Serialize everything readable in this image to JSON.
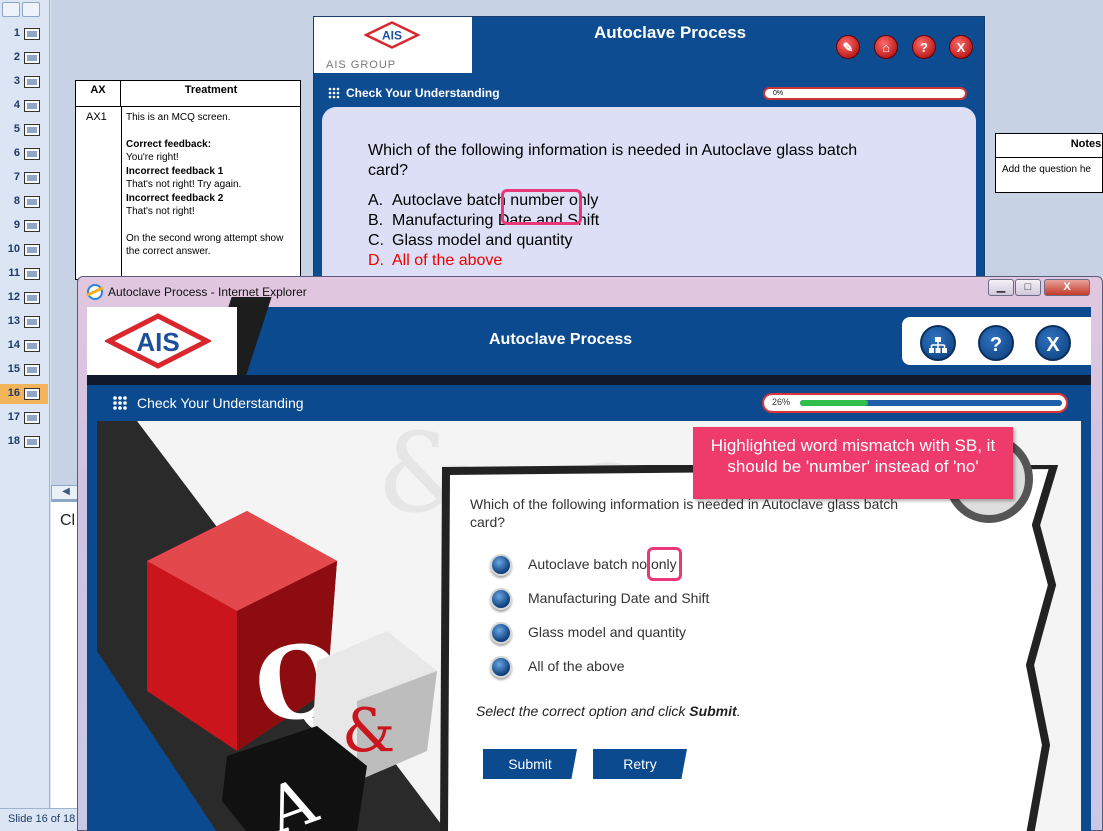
{
  "ppt": {
    "slide_numbers": [
      "1",
      "2",
      "3",
      "4",
      "5",
      "6",
      "7",
      "8",
      "9",
      "10",
      "11",
      "12",
      "13",
      "14",
      "15",
      "16",
      "17",
      "18"
    ],
    "active_slide": "16",
    "status": "Slide 16 of 18",
    "notes_peek": "Cl"
  },
  "treatment_table": {
    "col_ax": "AX",
    "col_treatment": "Treatment",
    "ax_value": "AX1",
    "line1": "This is an MCQ screen.",
    "correct_title": "Correct feedback:",
    "correct_text": "You're right!",
    "incorrect1_title": "Incorrect feedback 1",
    "incorrect1_text": "That's not right! Try again.",
    "incorrect2_title": "Incorrect feedback 2",
    "incorrect2_text": "That's not right!",
    "second_attempt": "On the second wrong attempt show the correct answer."
  },
  "notes_table": {
    "header": "Notes",
    "cell": "Add the question he"
  },
  "storyboard": {
    "logo_text": "AIS",
    "logo_sub": "AIS GROUP",
    "title": "Autoclave Process",
    "section": "Check Your Understanding",
    "progress_label": "0%",
    "question": "Which of the following information is needed in Autoclave glass batch card?",
    "options": [
      {
        "letter": "A.",
        "text": "Autoclave batch number only"
      },
      {
        "letter": "B.",
        "text": "Manufacturing Date and Shift"
      },
      {
        "letter": "C.",
        "text": "Glass model and quantity"
      },
      {
        "letter": "D.",
        "text": "All of the above"
      }
    ]
  },
  "ie": {
    "window_title": "Autoclave Process - Internet Explorer",
    "min": "▁",
    "max": "□",
    "close": "X"
  },
  "course": {
    "logo_text": "AIS",
    "title": "Autoclave Process",
    "btn_sitemap_icon": "sitemap-icon",
    "btn_help": "?",
    "btn_exit": "X",
    "section": "Check Your Understanding",
    "progress_label": "26%",
    "progress_value": 0.26,
    "question": "Which of the following information is needed in Autoclave glass batch card?",
    "options": [
      "Autoclave batch no only",
      "Manufacturing Date and Shift",
      "Glass model and quantity",
      "All of the above"
    ],
    "instruction_prefix": "Select the correct option and click ",
    "instruction_bold": "Submit",
    "instruction_suffix": ".",
    "submit": "Submit",
    "retry": "Retry"
  },
  "annotation": {
    "text": "Highlighted word mismatch with SB, it should be 'number' instead of 'no'"
  },
  "colors": {
    "brand_blue": "#0b4a8f",
    "annotation_pink": "#ee3b6c",
    "logo_red": "#d9272e",
    "progress_green": "#2fbf4a"
  }
}
